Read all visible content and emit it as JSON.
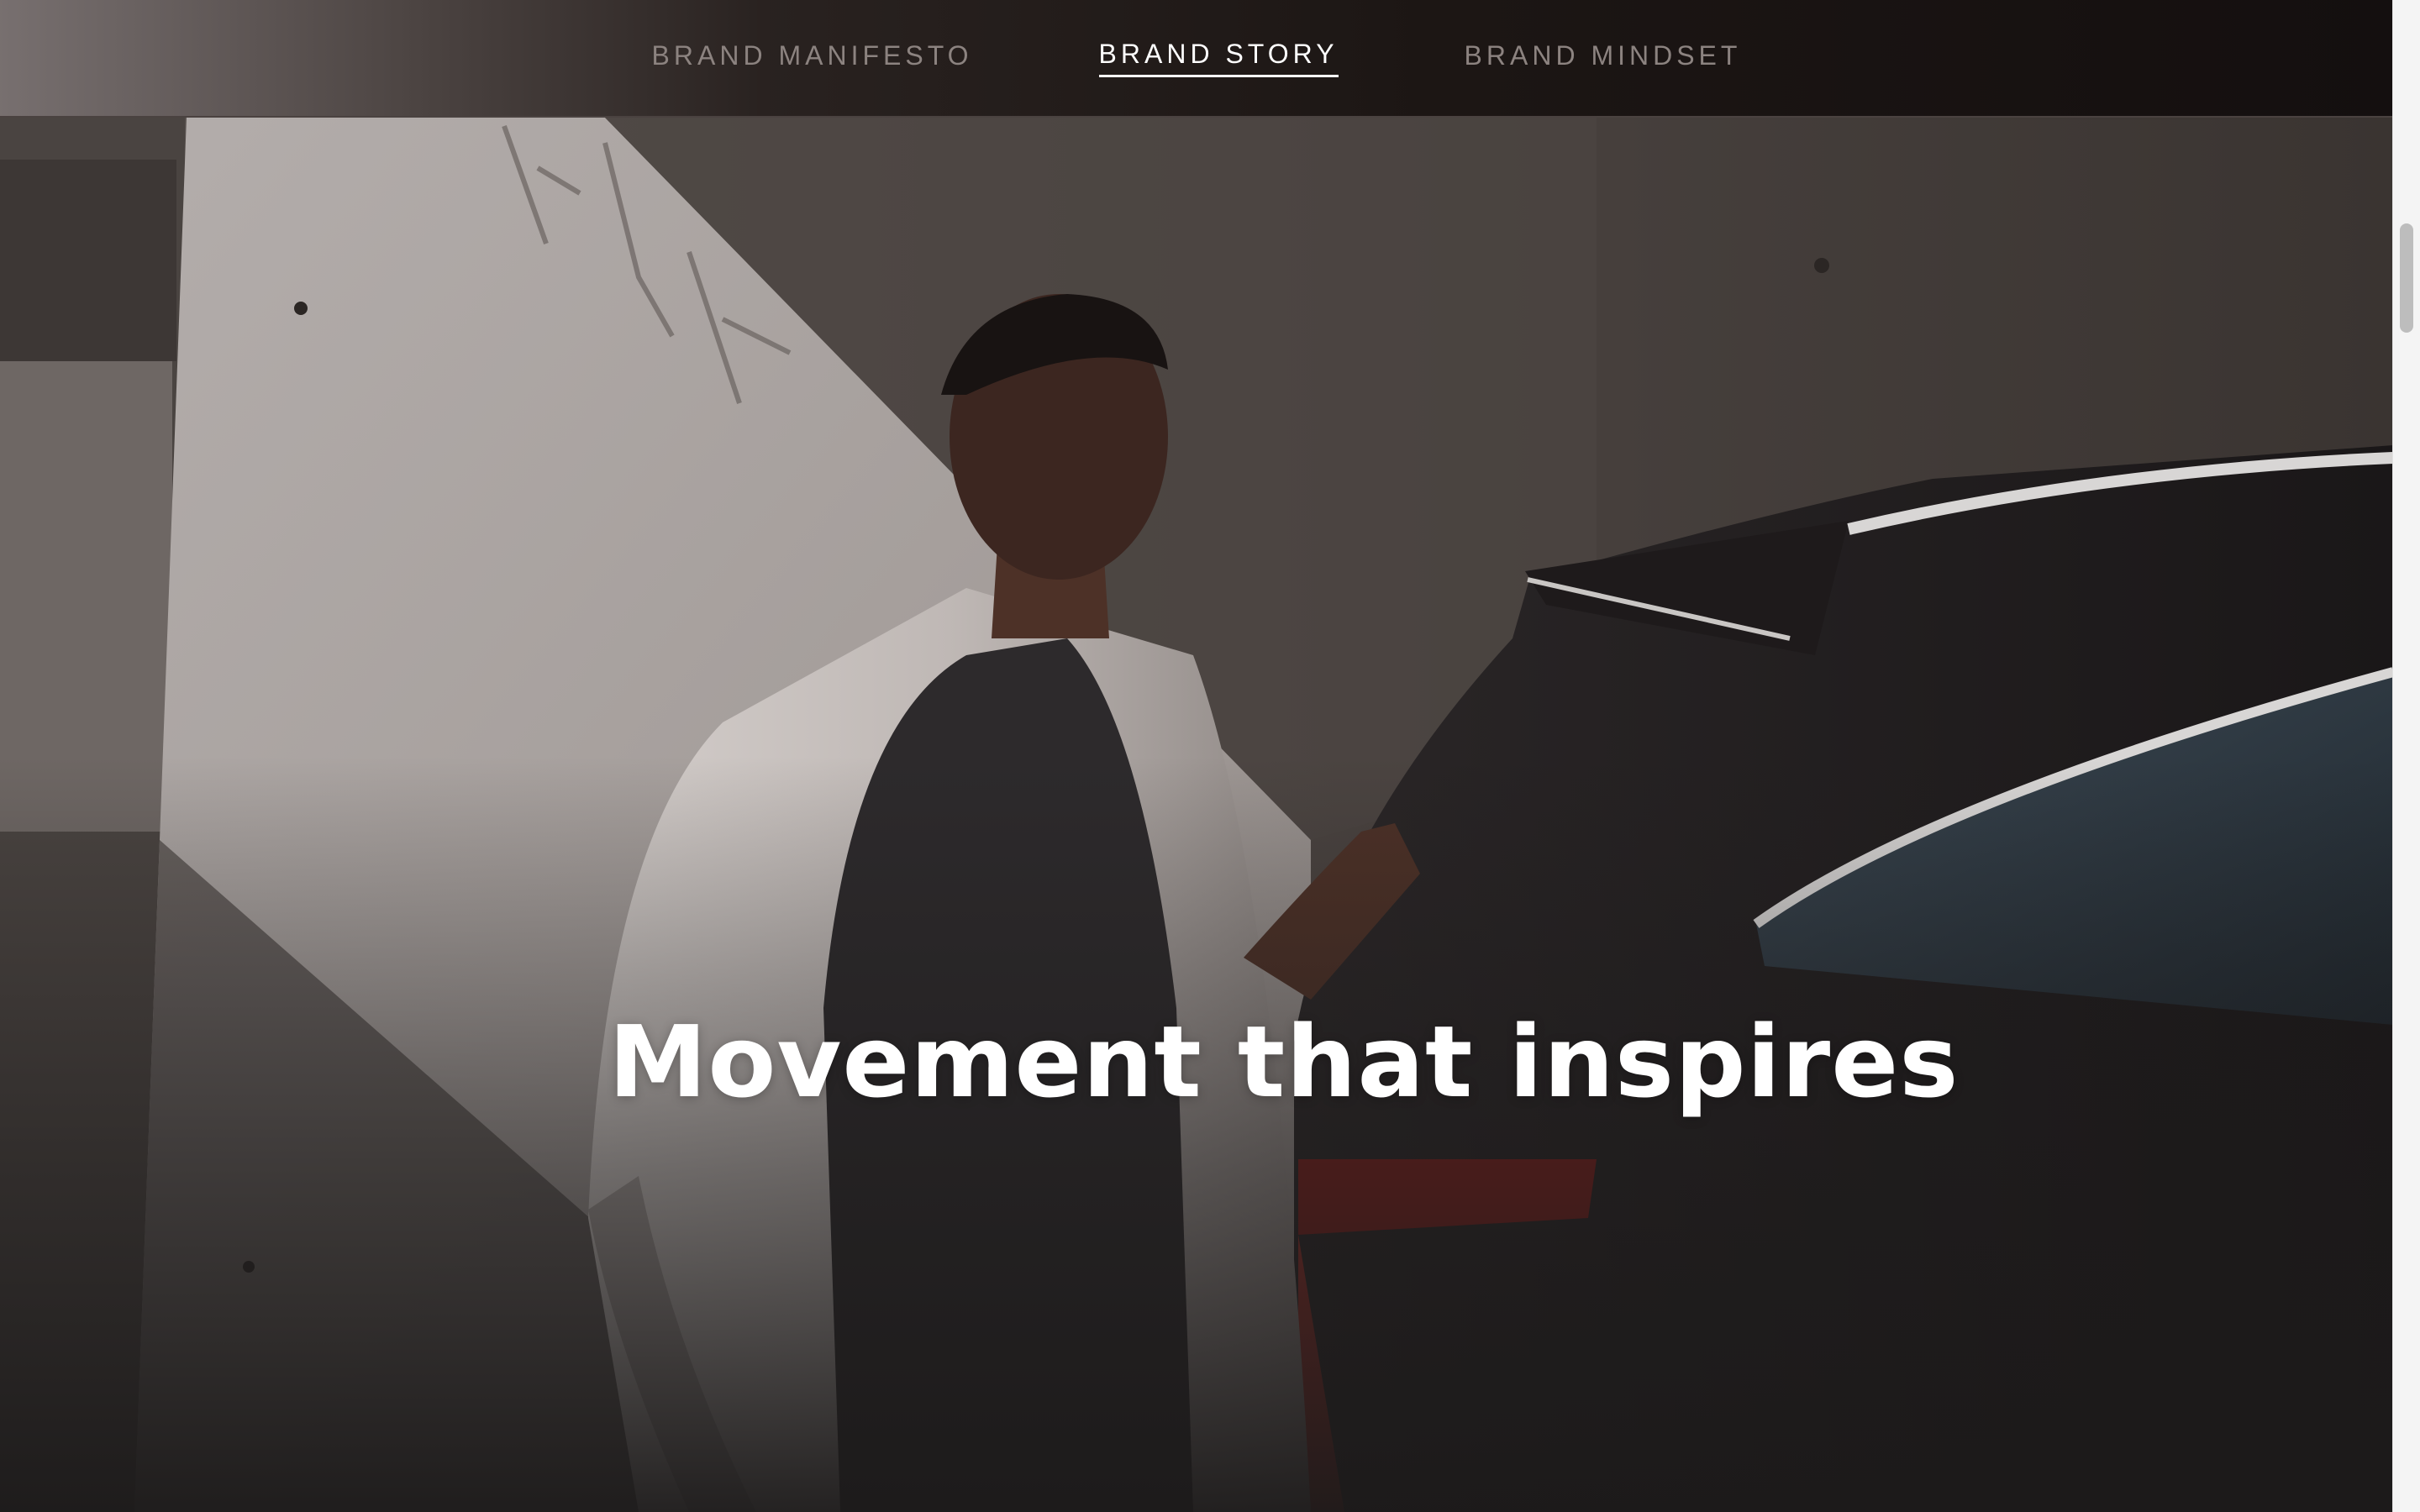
{
  "nav": {
    "items": [
      {
        "label": "BRAND MANIFESTO",
        "active": false
      },
      {
        "label": "BRAND STORY",
        "active": true
      },
      {
        "label": "BRAND MINDSET",
        "active": false
      }
    ]
  },
  "hero": {
    "headline": "Movement that inspires",
    "image": "woman-in-white-coat-beside-dark-suv"
  },
  "colors": {
    "nav_background": "#1c1614",
    "nav_inactive_text": "#8c8380",
    "nav_active_text": "#ffffff",
    "headline_text": "#ffffff"
  }
}
